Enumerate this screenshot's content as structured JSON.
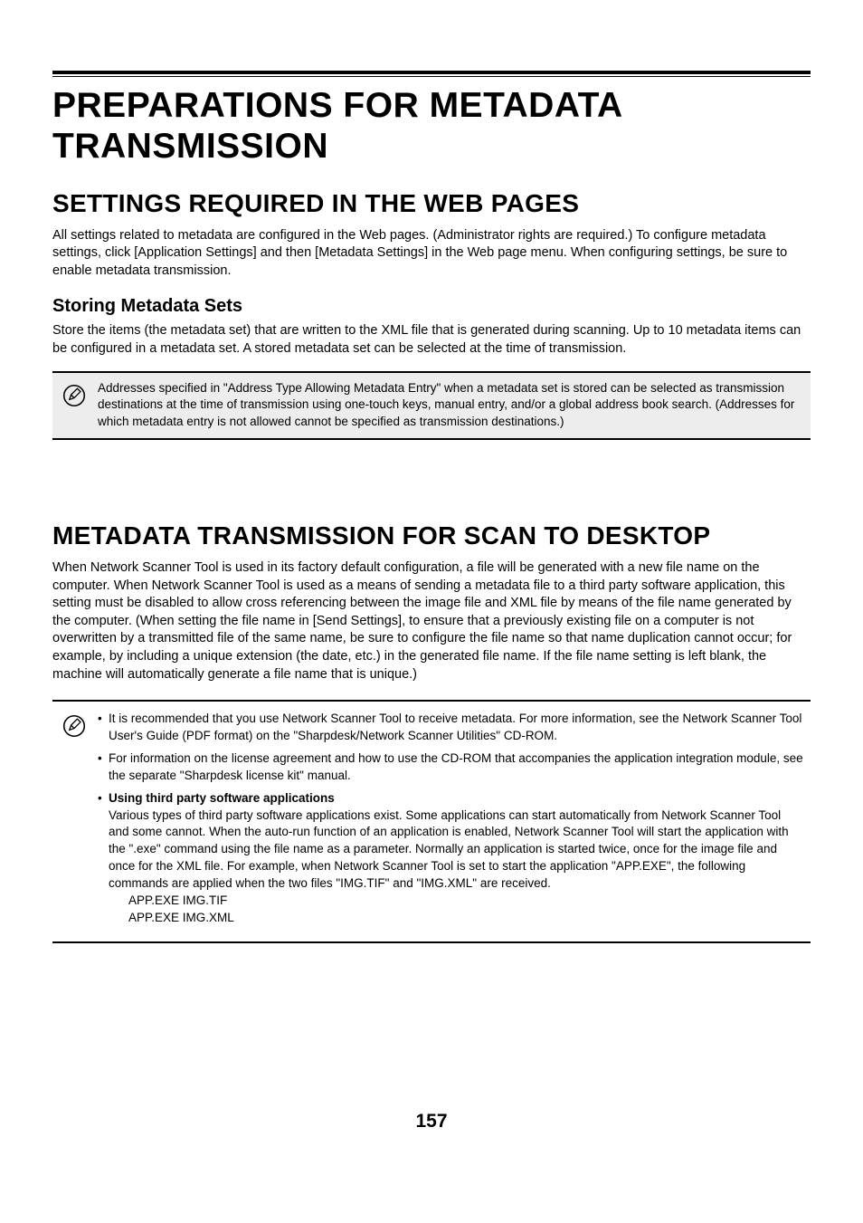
{
  "mainTitle": "PREPARATIONS FOR METADATA TRANSMISSION",
  "section1": {
    "title": "SETTINGS REQUIRED IN THE WEB PAGES",
    "body": "All settings related to metadata are configured in the Web pages. (Administrator rights are required.) To configure metadata settings, click [Application Settings] and then [Metadata Settings] in the Web page menu. When configuring settings, be sure to enable metadata transmission.",
    "subHeading": "Storing Metadata Sets",
    "subBody": "Store the items (the metadata set) that are written to the XML file that is generated during scanning. Up to 10 metadata items can be configured in a metadata set. A stored metadata set can be selected at the time of transmission.",
    "note": "Addresses specified in \"Address Type Allowing Metadata Entry\" when a metadata set is stored can be selected as transmission destinations at the time of transmission using one-touch keys, manual entry, and/or a global address book search. (Addresses for which metadata entry is not allowed cannot be specified as transmission destinations.)"
  },
  "section2": {
    "title": "METADATA TRANSMISSION FOR SCAN TO DESKTOP",
    "body": "When Network Scanner Tool is used in its factory default configuration, a file will be generated with a new file name on the computer. When Network Scanner Tool is used as a means of sending a metadata file to a third party software application, this setting must be disabled to allow cross referencing between the image file and XML file by means of the file name generated by the computer. (When setting the file name in [Send Settings], to ensure that a previously existing file on a computer is not overwritten by a transmitted file of the same name, be sure to configure the file name so that name duplication cannot occur; for example, by including a unique extension (the date, etc.) in the generated file name. If the file name setting is left blank, the machine will automatically generate a file name that is unique.)",
    "notes": {
      "item1": "It is recommended that you use Network Scanner Tool to receive metadata. For more information, see the Network Scanner Tool User's Guide (PDF format) on the \"Sharpdesk/Network Scanner Utilities\" CD-ROM.",
      "item2": "For information on the license agreement and how to use the CD-ROM that accompanies the application integration module, see the separate \"Sharpdesk license kit\" manual.",
      "item3Lead": "Using third party software applications",
      "item3Body": "Various types of third party software applications exist. Some applications can start automatically from Network Scanner Tool and some cannot. When the auto-run function of an application is enabled, Network Scanner Tool will start the application with the \".exe\" command using the file name as a parameter. Normally an application is started twice, once for the image file and once for the XML file. For example, when Network Scanner Tool is set to start the application \"APP.EXE\", the following commands are applied when the two files \"IMG.TIF\" and \"IMG.XML\" are received.",
      "item3Cmd1": "APP.EXE IMG.TIF",
      "item3Cmd2": "APP.EXE IMG.XML"
    }
  },
  "pageNumber": "157"
}
